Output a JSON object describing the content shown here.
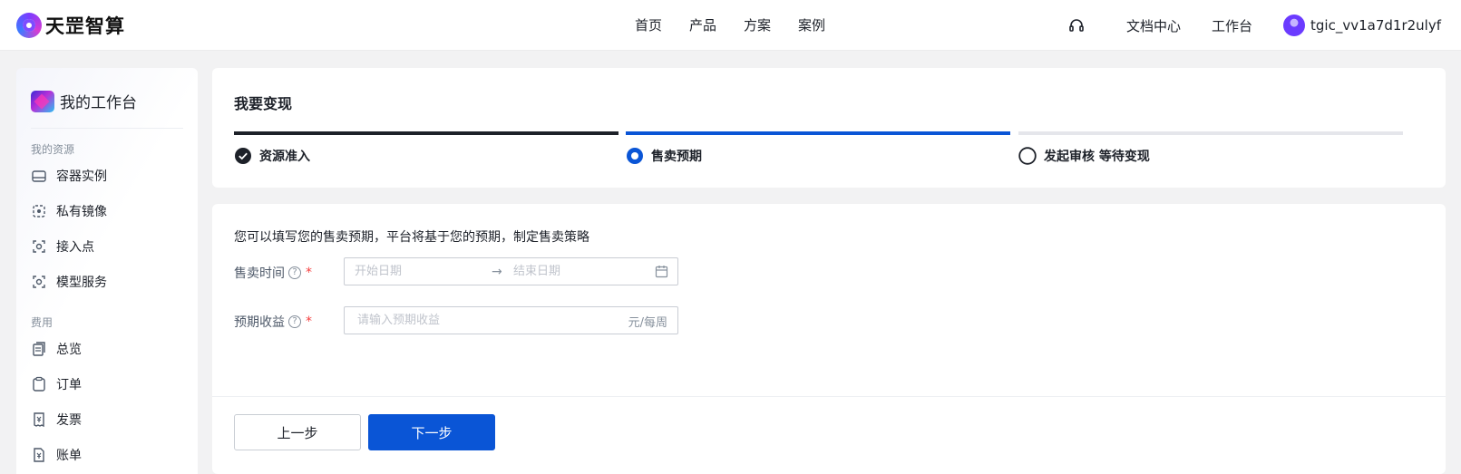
{
  "brand": {
    "name": "天罡智算"
  },
  "topnav": {
    "center": [
      "首页",
      "产品",
      "方案",
      "案例"
    ],
    "docs": "文档中心",
    "workbench": "工作台",
    "username": "tgic_vv1a7d1r2ulyf"
  },
  "sidebar": {
    "title": "我的工作台",
    "groups": [
      {
        "label": "我的资源",
        "items": [
          "容器实例",
          "私有镜像",
          "接入点",
          "模型服务"
        ]
      },
      {
        "label": "费用",
        "items": [
          "总览",
          "订单",
          "发票",
          "账单"
        ]
      }
    ]
  },
  "steps": {
    "title": "我要变现",
    "items": [
      {
        "label": "资源准入",
        "state": "done"
      },
      {
        "label": "售卖预期",
        "state": "active"
      },
      {
        "label": "发起审核 等待变现",
        "state": "pending"
      }
    ]
  },
  "form": {
    "intro": "您可以填写您的售卖预期，平台将基于您的预期，制定售卖策略",
    "sale_time": {
      "label": "售卖时间",
      "start_placeholder": "开始日期",
      "end_placeholder": "结束日期",
      "arrow": "→"
    },
    "revenue": {
      "label": "预期收益",
      "placeholder": "请输入预期收益",
      "suffix": "元/每周"
    },
    "required_mark": "*",
    "help_mark": "?"
  },
  "buttons": {
    "prev": "上一步",
    "next": "下一步"
  },
  "colors": {
    "primary": "#0a55d6",
    "done": "#1d2129",
    "pending": "#e5e6eb"
  }
}
